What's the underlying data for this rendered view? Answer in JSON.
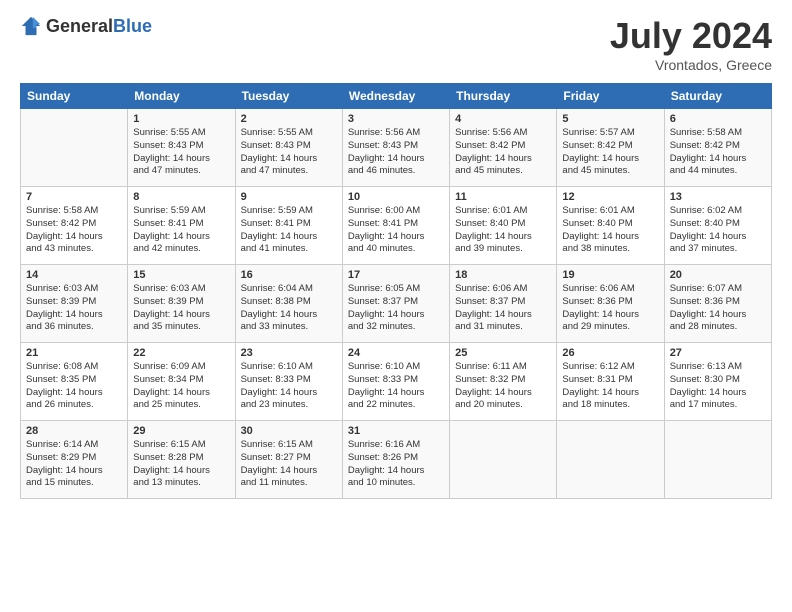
{
  "header": {
    "logo_general": "General",
    "logo_blue": "Blue",
    "month": "July 2024",
    "location": "Vrontados, Greece"
  },
  "days_of_week": [
    "Sunday",
    "Monday",
    "Tuesday",
    "Wednesday",
    "Thursday",
    "Friday",
    "Saturday"
  ],
  "weeks": [
    [
      {
        "day": "",
        "text": ""
      },
      {
        "day": "1",
        "text": "Sunrise: 5:55 AM\nSunset: 8:43 PM\nDaylight: 14 hours\nand 47 minutes."
      },
      {
        "day": "2",
        "text": "Sunrise: 5:55 AM\nSunset: 8:43 PM\nDaylight: 14 hours\nand 47 minutes."
      },
      {
        "day": "3",
        "text": "Sunrise: 5:56 AM\nSunset: 8:43 PM\nDaylight: 14 hours\nand 46 minutes."
      },
      {
        "day": "4",
        "text": "Sunrise: 5:56 AM\nSunset: 8:42 PM\nDaylight: 14 hours\nand 45 minutes."
      },
      {
        "day": "5",
        "text": "Sunrise: 5:57 AM\nSunset: 8:42 PM\nDaylight: 14 hours\nand 45 minutes."
      },
      {
        "day": "6",
        "text": "Sunrise: 5:58 AM\nSunset: 8:42 PM\nDaylight: 14 hours\nand 44 minutes."
      }
    ],
    [
      {
        "day": "7",
        "text": "Sunrise: 5:58 AM\nSunset: 8:42 PM\nDaylight: 14 hours\nand 43 minutes."
      },
      {
        "day": "8",
        "text": "Sunrise: 5:59 AM\nSunset: 8:41 PM\nDaylight: 14 hours\nand 42 minutes."
      },
      {
        "day": "9",
        "text": "Sunrise: 5:59 AM\nSunset: 8:41 PM\nDaylight: 14 hours\nand 41 minutes."
      },
      {
        "day": "10",
        "text": "Sunrise: 6:00 AM\nSunset: 8:41 PM\nDaylight: 14 hours\nand 40 minutes."
      },
      {
        "day": "11",
        "text": "Sunrise: 6:01 AM\nSunset: 8:40 PM\nDaylight: 14 hours\nand 39 minutes."
      },
      {
        "day": "12",
        "text": "Sunrise: 6:01 AM\nSunset: 8:40 PM\nDaylight: 14 hours\nand 38 minutes."
      },
      {
        "day": "13",
        "text": "Sunrise: 6:02 AM\nSunset: 8:40 PM\nDaylight: 14 hours\nand 37 minutes."
      }
    ],
    [
      {
        "day": "14",
        "text": "Sunrise: 6:03 AM\nSunset: 8:39 PM\nDaylight: 14 hours\nand 36 minutes."
      },
      {
        "day": "15",
        "text": "Sunrise: 6:03 AM\nSunset: 8:39 PM\nDaylight: 14 hours\nand 35 minutes."
      },
      {
        "day": "16",
        "text": "Sunrise: 6:04 AM\nSunset: 8:38 PM\nDaylight: 14 hours\nand 33 minutes."
      },
      {
        "day": "17",
        "text": "Sunrise: 6:05 AM\nSunset: 8:37 PM\nDaylight: 14 hours\nand 32 minutes."
      },
      {
        "day": "18",
        "text": "Sunrise: 6:06 AM\nSunset: 8:37 PM\nDaylight: 14 hours\nand 31 minutes."
      },
      {
        "day": "19",
        "text": "Sunrise: 6:06 AM\nSunset: 8:36 PM\nDaylight: 14 hours\nand 29 minutes."
      },
      {
        "day": "20",
        "text": "Sunrise: 6:07 AM\nSunset: 8:36 PM\nDaylight: 14 hours\nand 28 minutes."
      }
    ],
    [
      {
        "day": "21",
        "text": "Sunrise: 6:08 AM\nSunset: 8:35 PM\nDaylight: 14 hours\nand 26 minutes."
      },
      {
        "day": "22",
        "text": "Sunrise: 6:09 AM\nSunset: 8:34 PM\nDaylight: 14 hours\nand 25 minutes."
      },
      {
        "day": "23",
        "text": "Sunrise: 6:10 AM\nSunset: 8:33 PM\nDaylight: 14 hours\nand 23 minutes."
      },
      {
        "day": "24",
        "text": "Sunrise: 6:10 AM\nSunset: 8:33 PM\nDaylight: 14 hours\nand 22 minutes."
      },
      {
        "day": "25",
        "text": "Sunrise: 6:11 AM\nSunset: 8:32 PM\nDaylight: 14 hours\nand 20 minutes."
      },
      {
        "day": "26",
        "text": "Sunrise: 6:12 AM\nSunset: 8:31 PM\nDaylight: 14 hours\nand 18 minutes."
      },
      {
        "day": "27",
        "text": "Sunrise: 6:13 AM\nSunset: 8:30 PM\nDaylight: 14 hours\nand 17 minutes."
      }
    ],
    [
      {
        "day": "28",
        "text": "Sunrise: 6:14 AM\nSunset: 8:29 PM\nDaylight: 14 hours\nand 15 minutes."
      },
      {
        "day": "29",
        "text": "Sunrise: 6:15 AM\nSunset: 8:28 PM\nDaylight: 14 hours\nand 13 minutes."
      },
      {
        "day": "30",
        "text": "Sunrise: 6:15 AM\nSunset: 8:27 PM\nDaylight: 14 hours\nand 11 minutes."
      },
      {
        "day": "31",
        "text": "Sunrise: 6:16 AM\nSunset: 8:26 PM\nDaylight: 14 hours\nand 10 minutes."
      },
      {
        "day": "",
        "text": ""
      },
      {
        "day": "",
        "text": ""
      },
      {
        "day": "",
        "text": ""
      }
    ]
  ]
}
